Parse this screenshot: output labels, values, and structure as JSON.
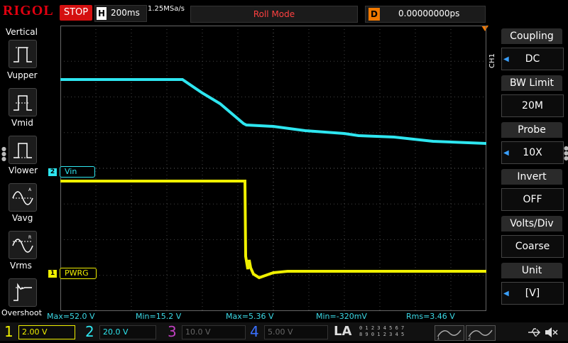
{
  "header": {
    "brand": "RIGOL",
    "run_state": "STOP",
    "timebase_label": "H",
    "timebase_value": "200ms",
    "sample_rate": "1.25MSa/s",
    "mode": "Roll Mode",
    "delay_label": "D",
    "delay_value": "0.00000000ps"
  },
  "left_menu": {
    "title": "Vertical",
    "items": [
      {
        "label": "Vupper",
        "icon": "vupper-icon"
      },
      {
        "label": "Vmid",
        "icon": "vmid-icon"
      },
      {
        "label": "Vlower",
        "icon": "vlower-icon"
      },
      {
        "label": "Vavg",
        "icon": "vavg-icon"
      },
      {
        "label": "Vrms",
        "icon": "vrms-icon"
      },
      {
        "label": "Overshoot",
        "icon": "overshoot-icon"
      }
    ]
  },
  "right_menu": {
    "channel_tag": "CH1",
    "items": [
      {
        "title": "Coupling",
        "value": "DC",
        "has_arrow": true
      },
      {
        "title": "BW Limit",
        "value": "20M",
        "has_arrow": false
      },
      {
        "title": "Probe",
        "value": "10X",
        "has_arrow": true
      },
      {
        "title": "Invert",
        "value": "OFF",
        "has_arrow": false
      },
      {
        "title": "Volts/Div",
        "value": "Coarse",
        "has_arrow": false
      },
      {
        "title": "Unit",
        "value": "[V]",
        "has_arrow": true
      }
    ]
  },
  "traces": {
    "ch1_label": "PWRG",
    "ch1_num": "1",
    "ch2_label": "Vin",
    "ch2_num": "2",
    "ch1_color": "#f0f000",
    "ch2_color": "#2ee6f0"
  },
  "measurements": {
    "max": "Max=52.0 V",
    "min": "Min=15.2 V",
    "max2": "Max=5.36 V",
    "min2": "Min=-320mV",
    "rms": "Rms=3.46 V"
  },
  "bottom": {
    "ch1": {
      "num": "1",
      "value": "2.00 V",
      "color": "#f0f000"
    },
    "ch2": {
      "num": "2",
      "value": "20.0 V",
      "color": "#2ee6f0"
    },
    "ch3": {
      "num": "3",
      "value": "10.0 V",
      "color": "#c040c0"
    },
    "ch4": {
      "num": "4",
      "value": "5.00 V",
      "color": "#3a70ff"
    },
    "la": "LA",
    "la_grid_row1": "0 1 2 3  4 5 6 7",
    "la_grid_row2": "8 9 0 1  2 3 4 5"
  }
}
